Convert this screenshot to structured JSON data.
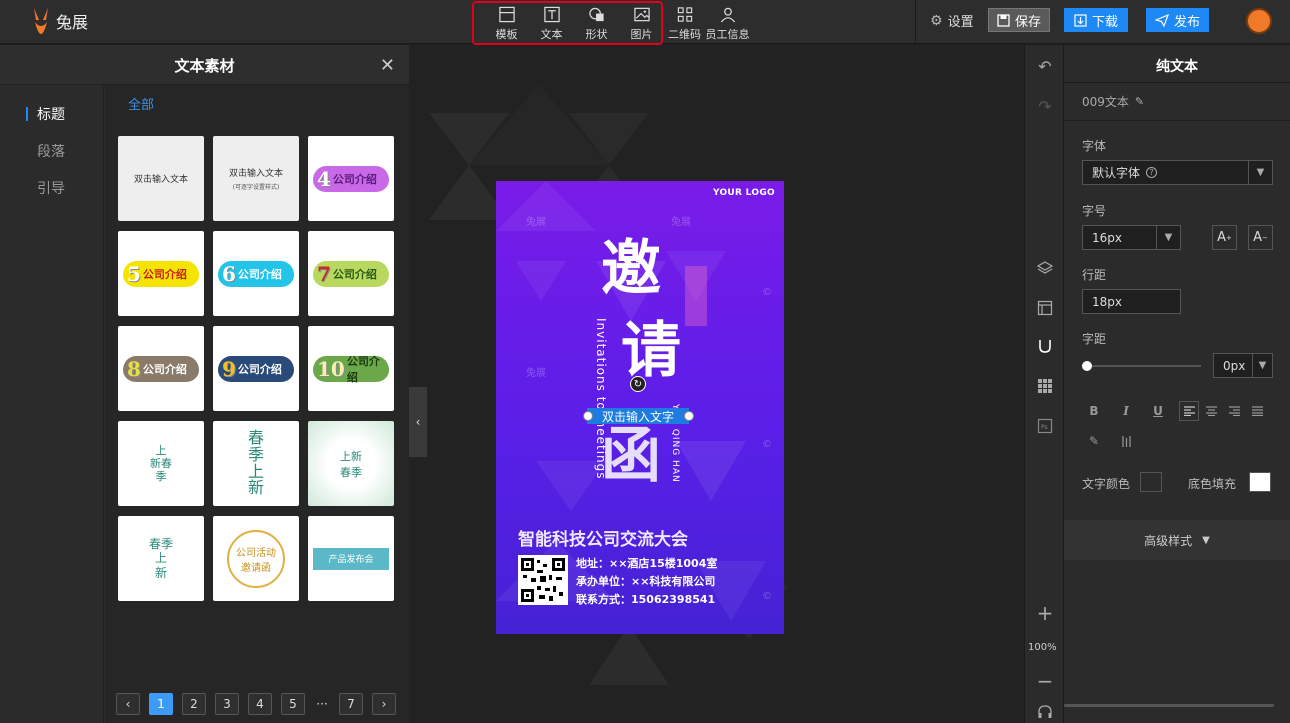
{
  "app": {
    "brand": "兔展"
  },
  "toolbar": {
    "tools": [
      {
        "label": "模板",
        "icon": "template-icon"
      },
      {
        "label": "文本",
        "icon": "text-icon"
      },
      {
        "label": "形状",
        "icon": "shape-icon"
      },
      {
        "label": "图片",
        "icon": "image-icon"
      }
    ],
    "qrcode_label": "二维码",
    "staff_label": "员工信息",
    "settings_label": "设置",
    "save_label": "保存",
    "download_label": "下载",
    "publish_label": "发布"
  },
  "left_panel": {
    "title": "文本素材",
    "nav": [
      "标题",
      "段落",
      "引导"
    ],
    "filter": "全部",
    "cards": {
      "c1": "双击输入文本",
      "c2": "双击输入文本",
      "c2_sub": "(可逐字设置样式)",
      "c3_num": "4",
      "c3_text": "公司介绍",
      "c4_num": "5",
      "c4_text": "公司介绍",
      "c5_num": "6",
      "c5_text": "公司介绍",
      "c6_num": "7",
      "c6_text": "公司介绍",
      "c7_num": "8",
      "c7_text": "公司介绍",
      "c8_num": "9",
      "c8_text": "公司介绍",
      "c9_num": "10",
      "c9_text": "公司介绍",
      "c10_a": "上",
      "c10_b": "新春",
      "c10_c": "季",
      "c11_a": "春",
      "c11_b": "季",
      "c11_c": "上",
      "c11_d": "新",
      "c12_a": "上新",
      "c12_b": "春季",
      "c13_a": "春季",
      "c13_b": "上",
      "c13_c": "新",
      "c14_a": "公司活动",
      "c14_b": "邀请函",
      "c15": "产品发布会"
    },
    "pager": [
      "1",
      "2",
      "3",
      "4",
      "5",
      "···",
      "7"
    ]
  },
  "poster": {
    "logo": "YOUR LOGO",
    "char1": "邀",
    "char2": "请",
    "char3": "函",
    "vertical_en_1": "Invitations to meetings",
    "vertical_en_2": "YAO QING HAN",
    "selected_text": "双击输入文字",
    "title": "智能科技公司交流大会",
    "address": "地址：××酒店15楼1004室",
    "organizer": "承办单位：××科技有限公司",
    "contact": "联系方式：15062398541",
    "watermark": "兔展"
  },
  "right_toolbar": {
    "zoom": "100%"
  },
  "right_panel": {
    "title": "纯文本",
    "element_name": "009文本",
    "font_label": "字体",
    "font_value": "默认字体",
    "size_label": "字号",
    "size_value": "16px",
    "line_height_label": "行距",
    "line_height_value": "18px",
    "spacing_label": "字距",
    "spacing_value": "0px",
    "text_color_label": "文字颜色",
    "bg_fill_label": "底色填充",
    "advanced_label": "高级样式"
  },
  "colors": {
    "accent": "#1e88f5",
    "highlight_box": "#e0001a",
    "poster_top": "#7a1be8",
    "poster_bottom": "#4522d4"
  }
}
